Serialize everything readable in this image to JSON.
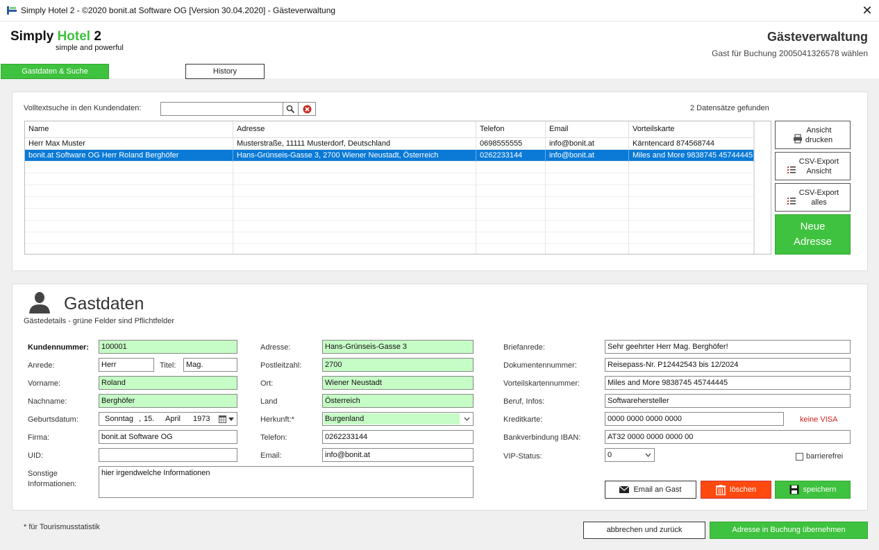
{
  "window": {
    "title": "Simply Hotel 2 - ©2020 bonit.at Software OG [Version 30.04.2020] - Gästeverwaltung",
    "close_glyph": "✕"
  },
  "header": {
    "logo_part1": "Simply ",
    "logo_part2": "Hotel",
    "logo_part3": " 2",
    "logo_tagline": "simple and powerful",
    "heading": "Gästeverwaltung",
    "subheading": "Gast für Buchung 2005041326578 wählen",
    "accent_color": "#3fc23f"
  },
  "tabs": {
    "gastdaten": "Gastdaten & Suche",
    "history": "History"
  },
  "search": {
    "label": "Volltextsuche in den Kundendaten:",
    "value": "",
    "result_count": "2 Datensätze gefunden"
  },
  "table": {
    "columns": [
      "Name",
      "Adresse",
      "Telefon",
      "Email",
      "Vorteilskarte"
    ],
    "rows": [
      [
        "Herr Max Muster",
        "Musterstraße, 11111 Musterdorf, Deutschland",
        "0698555555",
        "info@bonit.at",
        "Kärntencard 874568744"
      ],
      [
        "bonit.at Software OG Herr Roland Berghöfer",
        "Hans-Grünseis-Gasse 3, 2700 Wiener Neustadt, Österreich",
        "0262233144",
        "info@bonit.at",
        "Miles and More 9838745 45744445"
      ]
    ],
    "selected_row": 1,
    "selection_color": "#0a7ad6"
  },
  "side_buttons": {
    "print_line1": "Ansicht",
    "print_line2": "drucken",
    "csv_view_line1": "CSV-Export",
    "csv_view_line2": "Ansicht",
    "csv_all_line1": "CSV-Export",
    "csv_all_line2": "alles",
    "new_line1": "Neue",
    "new_line2": "Adresse"
  },
  "guest": {
    "title": "Gastdaten",
    "subtitle": "Gästedetails - grüne Felder sind Pflichtfelder",
    "labels": {
      "kundennummer": "Kundennummer:",
      "anrede": "Anrede:",
      "titel": "Titel:",
      "vorname": "Vorname:",
      "nachname": "Nachname:",
      "geburtsdatum": "Geburtsdatum:",
      "firma": "Firma:",
      "uid": "UID:",
      "sonstige1": "Sonstige",
      "sonstige2": "Informationen:",
      "adresse": "Adresse:",
      "plz": "Postleitzahl:",
      "ort": "Ort:",
      "land": "Land",
      "herkunft": "Herkunft:*",
      "telefon": "Telefon:",
      "email": "Email:",
      "briefanrede": "Briefanrede:",
      "dokumentennummer": "Dokumentennummer:",
      "vorteilskarte": "Vorteilskartennummer:",
      "beruf": "Beruf, Infos:",
      "kreditkarte": "Kreditkarte:",
      "iban": "Bankverbindung IBAN:",
      "vip": "VIP-Status:",
      "barrierefrei": "barrierefrei"
    },
    "values": {
      "kundennummer": "100001",
      "anrede": "Herr",
      "titel": "Mag.",
      "vorname": "Roland",
      "nachname": "Berghöfer",
      "geb_weekday": "Sonntag",
      "geb_sep": ",",
      "geb_day": "15.",
      "geb_month": "April",
      "geb_year": "1973",
      "firma": "bonit.at Software OG",
      "uid": "",
      "sonstige": "hier irgendwelche Informationen",
      "adresse": "Hans-Grünseis-Gasse 3",
      "plz": "2700",
      "ort": "Wiener Neustadt",
      "land": "Österreich",
      "herkunft": "Burgenland",
      "telefon": "0262233144",
      "email": "info@bonit.at",
      "briefanrede": "Sehr geehrter Herr Mag. Berghöfer!",
      "dokumentennummer": "Reisepass-Nr. P12442543 bis 12/2024",
      "vorteilskarte": "Miles and More 9838745 45744445",
      "beruf": "Softwarehersteller",
      "kreditkarte": "0000 0000 0000 0000",
      "kreditkarte_hint": "keine VISA",
      "iban": "AT32 0000 0000 0000 00",
      "vip": "0"
    },
    "buttons": {
      "email": "Email an Gast",
      "loeschen": "löschen",
      "speichern": "speichern"
    }
  },
  "footer": {
    "note": "* für Tourismusstatistik",
    "abbrechen": "abbrechen und zurück",
    "uebernehmen": "Adresse in Buchung übernehmen"
  }
}
